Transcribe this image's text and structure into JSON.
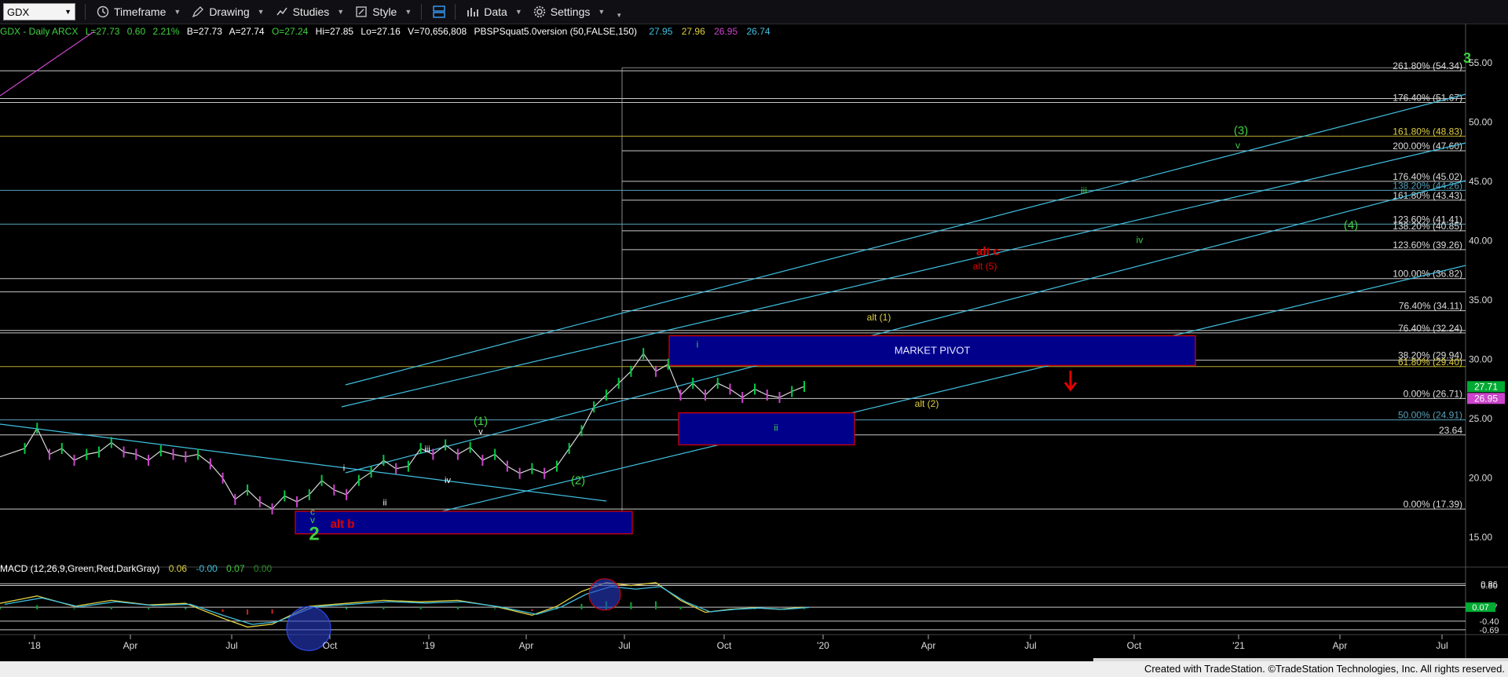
{
  "toolbar": {
    "symbol": "GDX",
    "items": [
      {
        "label": "Timeframe",
        "icon": "clock-icon"
      },
      {
        "label": "Drawing",
        "icon": "pencil-icon"
      },
      {
        "label": "Studies",
        "icon": "studies-icon"
      },
      {
        "label": "Style",
        "icon": "style-icon"
      },
      {
        "label": "Data",
        "icon": "data-icon"
      },
      {
        "label": "Settings",
        "icon": "gear-icon"
      }
    ]
  },
  "header": {
    "prefix": "GDX - Daily  ARCX",
    "last": "L=27.73",
    "change": "0.60",
    "change_pct": "2.21%",
    "bid": "B=27.73",
    "ask": "A=27.74",
    "open": "O=27.24",
    "high": "Hi=27.85",
    "low": "Lo=27.16",
    "volume": "V=70,656,808",
    "study": "PBSPSquat5.0version (50,FALSE,150)",
    "study_values": [
      "27.95",
      "27.96",
      "26.95",
      "26.74"
    ]
  },
  "macd_header": {
    "label": "MACD (12,26,9,Green,Red,DarkGray)",
    "values": [
      "0.06",
      "-0.00",
      "0.07",
      "0.00"
    ]
  },
  "footer": {
    "credit": "Created with TradeStation. ©TradeStation Technologies, Inc. All rights reserved."
  },
  "colors": {
    "up": "#00cc44",
    "down": "#cc44cc",
    "fib": "#c8c8c8",
    "channel": "#40c0e0",
    "zone": "#00008b",
    "zone_border": "#e00000",
    "count": "#40d040",
    "alt": "#e00000",
    "alt_yellow": "#e0d040"
  },
  "chart_data": [
    {
      "type": "candlestick",
      "title": "GDX - Daily",
      "x_ticks": [
        "'18",
        "Apr",
        "Jul",
        "Oct",
        "'19",
        "Apr",
        "Jul",
        "Oct",
        "'20",
        "Apr",
        "Jul",
        "Oct",
        "'21",
        "Apr",
        "Jul"
      ],
      "y_ticks": [
        15.0,
        20.0,
        25.0,
        30.0,
        35.0,
        40.0,
        45.0,
        50.0,
        55.0
      ],
      "ylim": [
        12.5,
        57
      ],
      "last_price_labels": [
        "27.71",
        "26.95"
      ],
      "price_path": [
        [
          0,
          21.8
        ],
        [
          2,
          22.5
        ],
        [
          3,
          24.2
        ],
        [
          4,
          22.0
        ],
        [
          5,
          22.5
        ],
        [
          6,
          21.5
        ],
        [
          7,
          22.0
        ],
        [
          8,
          22.2
        ],
        [
          9,
          23.0
        ],
        [
          10,
          22.2
        ],
        [
          11,
          22.0
        ],
        [
          12,
          21.5
        ],
        [
          13,
          22.3
        ],
        [
          14,
          22.0
        ],
        [
          15,
          21.8
        ],
        [
          16,
          22.0
        ],
        [
          17,
          21.2
        ],
        [
          18,
          20.0
        ],
        [
          19,
          18.2
        ],
        [
          20,
          19.0
        ],
        [
          21,
          18.0
        ],
        [
          22,
          17.4
        ],
        [
          23,
          18.5
        ],
        [
          24,
          18.0
        ],
        [
          25,
          18.6
        ],
        [
          26,
          19.8
        ],
        [
          27,
          19.0
        ],
        [
          28,
          18.6
        ],
        [
          29,
          19.8
        ],
        [
          30,
          20.5
        ],
        [
          31,
          21.5
        ],
        [
          32,
          20.8
        ],
        [
          33,
          21.0
        ],
        [
          34,
          22.5
        ],
        [
          35,
          22.0
        ],
        [
          36,
          22.8
        ],
        [
          37,
          22.0
        ],
        [
          38,
          22.6
        ],
        [
          39,
          21.5
        ],
        [
          40,
          22.0
        ],
        [
          41,
          21.0
        ],
        [
          42,
          20.4
        ],
        [
          43,
          20.8
        ],
        [
          44,
          20.4
        ],
        [
          45,
          21.0
        ],
        [
          46,
          22.5
        ],
        [
          47,
          24.0
        ],
        [
          48,
          26.0
        ],
        [
          49,
          27.0
        ],
        [
          50,
          28.0
        ],
        [
          51,
          29.0
        ],
        [
          52,
          30.5
        ],
        [
          53,
          29.0
        ],
        [
          54,
          29.6
        ],
        [
          55,
          27.0
        ],
        [
          56,
          28.0
        ],
        [
          57,
          27.0
        ],
        [
          58,
          28.0
        ],
        [
          59,
          27.5
        ],
        [
          60,
          26.8
        ],
        [
          61,
          27.5
        ],
        [
          62,
          27.0
        ],
        [
          63,
          26.8
        ],
        [
          64,
          27.3
        ],
        [
          65,
          27.73
        ]
      ],
      "macd_path": [
        [
          0,
          0.2
        ],
        [
          3,
          0.45
        ],
        [
          6,
          0.1
        ],
        [
          9,
          0.3
        ],
        [
          12,
          0.15
        ],
        [
          15,
          0.2
        ],
        [
          18,
          -0.3
        ],
        [
          20,
          -0.6
        ],
        [
          22,
          -0.5
        ],
        [
          25,
          0.1
        ],
        [
          28,
          0.2
        ],
        [
          31,
          0.3
        ],
        [
          34,
          0.25
        ],
        [
          37,
          0.3
        ],
        [
          40,
          0.1
        ],
        [
          43,
          -0.2
        ],
        [
          45,
          0.1
        ],
        [
          47,
          0.6
        ],
        [
          49,
          0.9
        ],
        [
          51,
          0.8
        ],
        [
          53,
          0.9
        ],
        [
          55,
          0.3
        ],
        [
          57,
          -0.1
        ],
        [
          59,
          0.0
        ],
        [
          61,
          0.05
        ],
        [
          63,
          0.0
        ],
        [
          65,
          0.07
        ]
      ],
      "macd_ticks": [
        "0.86",
        "0.80",
        "0.07",
        "-0.40",
        "-0.69"
      ],
      "fib_levels": [
        {
          "label": "261.80% (54.34)",
          "price": 54.34
        },
        {
          "label": "176.40% (51.67)",
          "price": 51.67
        },
        {
          "label": "161.80% (48.83)",
          "price": 48.83
        },
        {
          "label": "200.00% (47.60)",
          "price": 47.6
        },
        {
          "label": "176.40% (45.02)",
          "price": 45.02
        },
        {
          "label": "138.20% (44.26)",
          "price": 44.26
        },
        {
          "label": "161.80% (43.43)",
          "price": 43.43
        },
        {
          "label": "123.60% (41.41)",
          "price": 41.41
        },
        {
          "label": "138.20% (40.85)",
          "price": 40.85
        },
        {
          "label": "123.60% (39.26)",
          "price": 39.26
        },
        {
          "label": "100.00% (36.82)",
          "price": 36.82
        },
        {
          "label": "76.40% (34.11)",
          "price": 34.11
        },
        {
          "label": "76.40% (32.24)",
          "price": 32.24
        },
        {
          "label": "38.20% (29.94)",
          "price": 29.94
        },
        {
          "label": "61.80% (29.40)",
          "price": 29.4
        },
        {
          "label": "0.00% (26.71)",
          "price": 26.71
        },
        {
          "label": "50.00% (24.91)",
          "price": 24.91
        },
        {
          "label": "23.64",
          "price": 23.64
        },
        {
          "label": "0.00% (17.39)",
          "price": 17.39
        }
      ],
      "zones": [
        {
          "label": "MARKET PIVOT",
          "price_top": 32.0,
          "price_bottom": 29.5
        },
        {
          "label": "",
          "price_top": 25.5,
          "price_bottom": 22.8
        },
        {
          "label": "",
          "price_top": 17.2,
          "price_bottom": 15.3
        }
      ],
      "wave_labels": [
        {
          "text": "3",
          "price": 55.0,
          "style": "count"
        },
        {
          "text": "(3)",
          "price": 49.0,
          "style": "count"
        },
        {
          "text": "v",
          "price": 47.8,
          "style": "count-small"
        },
        {
          "text": "iii",
          "price": 44.0,
          "style": "count-small"
        },
        {
          "text": "(4)",
          "price": 41.0,
          "style": "count"
        },
        {
          "text": "iv",
          "price": 39.8,
          "style": "count-small"
        },
        {
          "text": "alt c",
          "price": 38.8,
          "style": "alt-bold"
        },
        {
          "text": "alt (5)",
          "price": 37.6,
          "style": "alt"
        },
        {
          "text": "alt (1)",
          "price": 33.3,
          "style": "alt-yellow"
        },
        {
          "text": "i",
          "price": 31.0,
          "style": "count-small"
        },
        {
          "text": "alt (2)",
          "price": 26.0,
          "style": "alt-yellow"
        },
        {
          "text": "ii",
          "price": 24.0,
          "style": "count-small"
        },
        {
          "text": "(1)",
          "price": 24.5,
          "style": "count"
        },
        {
          "text": "v",
          "price": 23.7,
          "style": "white-small"
        },
        {
          "text": "iii",
          "price": 22.2,
          "style": "white-small"
        },
        {
          "text": "i",
          "price": 20.6,
          "style": "white-small"
        },
        {
          "text": "iv",
          "price": 19.6,
          "style": "white-small"
        },
        {
          "text": "(2)",
          "price": 19.5,
          "style": "count"
        },
        {
          "text": "ii",
          "price": 17.7,
          "style": "white-small"
        },
        {
          "text": "c",
          "price": 16.9,
          "style": "count-small"
        },
        {
          "text": "v",
          "price": 16.2,
          "style": "count-small"
        },
        {
          "text": "2",
          "price": 14.8,
          "style": "count-big"
        },
        {
          "text": "alt b",
          "price": 15.8,
          "style": "alt-bold"
        }
      ]
    }
  ]
}
